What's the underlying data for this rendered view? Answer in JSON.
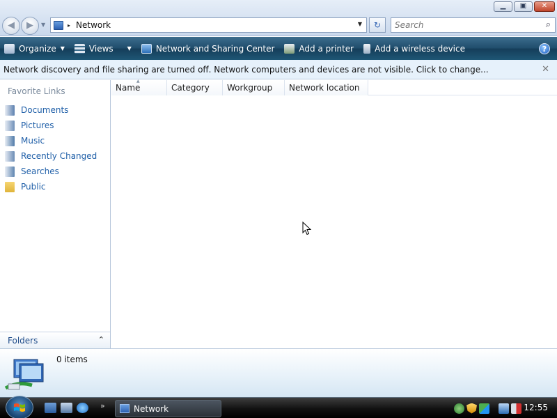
{
  "window": {
    "minimize_label": "▁",
    "maximize_label": "▣",
    "close_label": "✕"
  },
  "address": {
    "location": "Network",
    "separator": "▸",
    "dropdown": "▼",
    "refresh": "↻"
  },
  "search": {
    "placeholder": "Search",
    "icon": "⌕"
  },
  "toolbar": {
    "items": [
      {
        "label": "Organize",
        "has_dropdown": true,
        "icon": "organize-icon"
      },
      {
        "label": "Views",
        "has_dropdown": true,
        "icon": "views-icon"
      },
      {
        "label": "Network and Sharing Center",
        "icon": "network-sharing-icon"
      },
      {
        "label": "Add a printer",
        "icon": "printer-icon"
      },
      {
        "label": "Add a wireless device",
        "icon": "wireless-device-icon"
      }
    ],
    "dropdown_arrow": "▼",
    "help_label": "?"
  },
  "infobar": {
    "message": "Network discovery and file sharing are turned off. Network computers and devices are not visible. Click to change...",
    "close": "✕"
  },
  "sidebar": {
    "title": "Favorite Links",
    "links": [
      {
        "label": "Documents",
        "color": "#5b7fae"
      },
      {
        "label": "Pictures",
        "color": "#6f8fb8"
      },
      {
        "label": "Music",
        "color": "#4f7aa8"
      },
      {
        "label": "Recently Changed",
        "color": "#6a8bb5"
      },
      {
        "label": "Searches",
        "color": "#5d84b0"
      },
      {
        "label": "Public",
        "color": "#e0b43a"
      }
    ],
    "folders_label": "Folders",
    "folders_toggle": "⌃"
  },
  "list": {
    "columns": [
      {
        "label": "Name",
        "sorted": true
      },
      {
        "label": "Category"
      },
      {
        "label": "Workgroup"
      },
      {
        "label": "Network location"
      }
    ],
    "rows": []
  },
  "details": {
    "count": "0 items"
  },
  "taskbar": {
    "chevron": "»",
    "window_button": "Network",
    "clock": "12:55"
  },
  "colors": {
    "command_bar": "#1f4c6b",
    "link": "#1f5fa8",
    "infobar_bg": "#e6f1fb"
  }
}
